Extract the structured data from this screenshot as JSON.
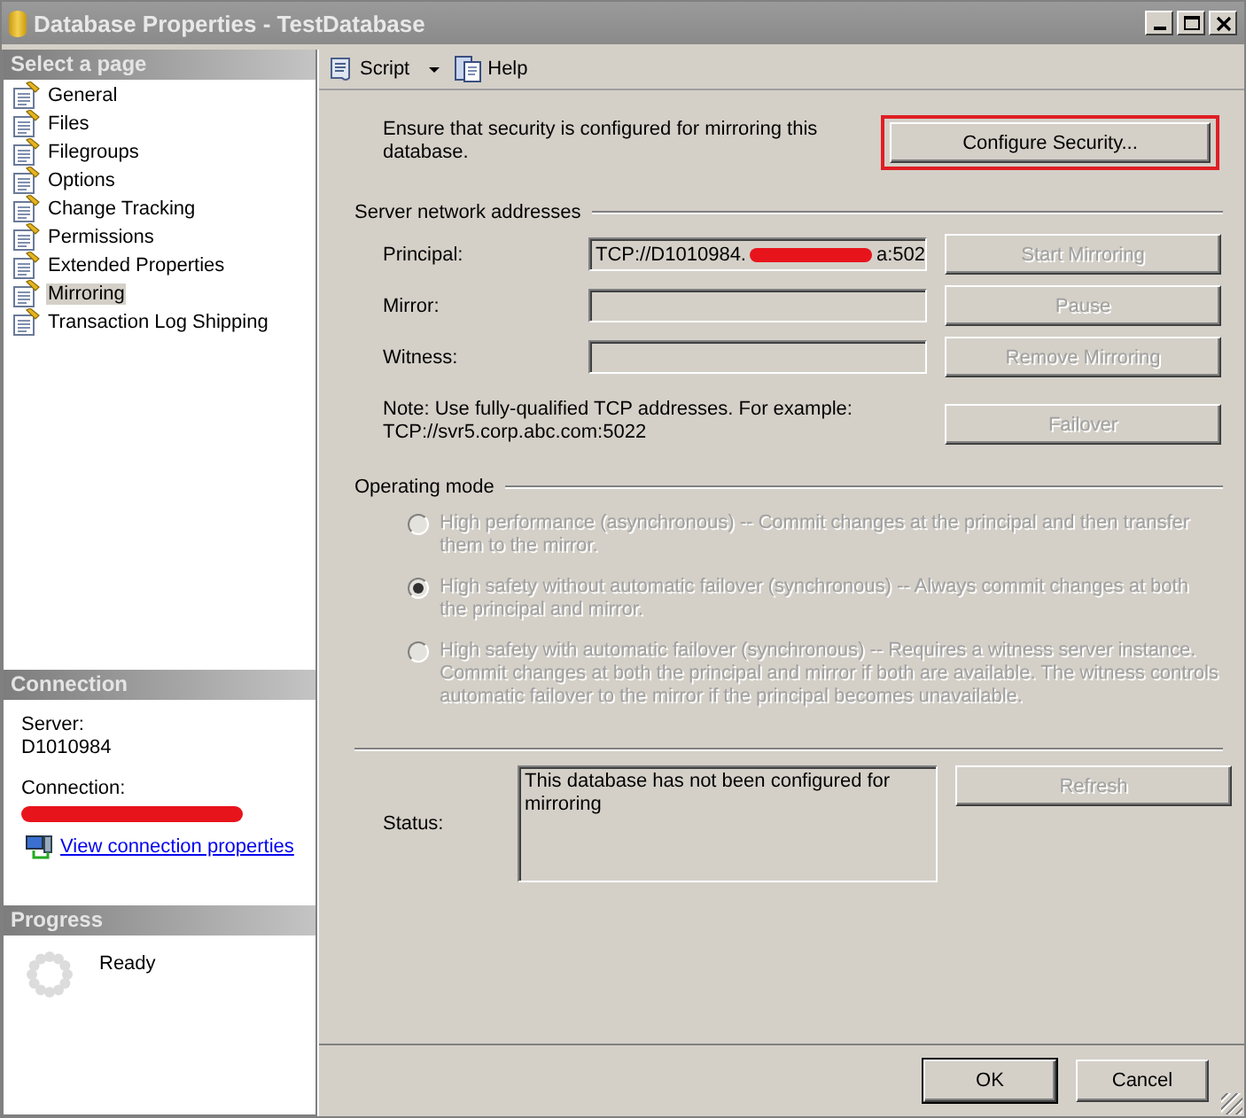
{
  "window": {
    "title": "Database Properties - TestDatabase"
  },
  "sidebar": {
    "header": "Select a page",
    "items": [
      {
        "label": "General",
        "selected": false
      },
      {
        "label": "Files",
        "selected": false
      },
      {
        "label": "Filegroups",
        "selected": false
      },
      {
        "label": "Options",
        "selected": false
      },
      {
        "label": "Change Tracking",
        "selected": false
      },
      {
        "label": "Permissions",
        "selected": false
      },
      {
        "label": "Extended Properties",
        "selected": false
      },
      {
        "label": "Mirroring",
        "selected": true
      },
      {
        "label": "Transaction Log Shipping",
        "selected": false
      }
    ]
  },
  "connection": {
    "header": "Connection",
    "server_label": "Server:",
    "server": "D1010984",
    "connection_label": "Connection:",
    "connection_redacted": true,
    "link": "View connection properties"
  },
  "progress": {
    "header": "Progress",
    "status": "Ready"
  },
  "toolbar": {
    "items": [
      {
        "kind": "script",
        "label": "Script"
      },
      {
        "kind": "help",
        "label": "Help"
      }
    ]
  },
  "security": {
    "text": "Ensure that security is configured for mirroring this database.",
    "button": {
      "label": "Configure Security...",
      "disabled": false,
      "highlighted": true
    }
  },
  "addresses": {
    "title": "Server network addresses",
    "rows": [
      {
        "label": "Principal:",
        "value_start": "TCP://D1010984.",
        "value_end": "a:502",
        "redacted": true,
        "button": {
          "label": "Start Mirroring",
          "disabled": true
        }
      },
      {
        "label": "Mirror:",
        "button": {
          "label": "Pause",
          "disabled": true
        }
      },
      {
        "label": "Witness:",
        "button": {
          "label": "Remove Mirroring",
          "disabled": true
        }
      }
    ],
    "note": "Note: Use fully-qualified TCP addresses. For example: TCP://svr5.corp.abc.com:5022",
    "note_button": {
      "label": "Failover",
      "disabled": true
    }
  },
  "operating_mode": {
    "title": "Operating mode",
    "options": [
      {
        "label": "High performance (asynchronous) -- Commit changes at the principal and then transfer them to the mirror.",
        "selected": false,
        "disabled": true
      },
      {
        "label": "High safety without automatic failover (synchronous) -- Always commit changes at both the principal and mirror.",
        "selected": true,
        "disabled": true
      },
      {
        "label": "High safety with automatic failover (synchronous) -- Requires a witness server instance. Commit changes at both the principal and mirror if both are available. The witness controls automatic failover to the mirror if the principal becomes unavailable.",
        "selected": false,
        "disabled": true
      }
    ]
  },
  "status": {
    "label": "Status:",
    "text": "This database has not been configured for mirroring",
    "button": {
      "label": "Refresh",
      "disabled": true
    }
  },
  "buttons": [
    {
      "label": "OK",
      "default": true
    },
    {
      "label": "Cancel",
      "default": false
    }
  ]
}
